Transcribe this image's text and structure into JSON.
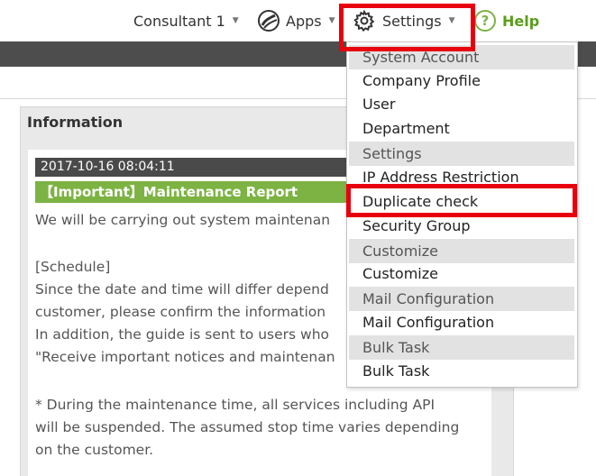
{
  "topbar": {
    "consultant_label": "Consultant 1",
    "apps_label": "Apps",
    "settings_label": "Settings",
    "help_label": "Help",
    "help_icon_glyph": "?",
    "caret": "▼"
  },
  "information": {
    "title": "Information",
    "notice": {
      "date": "2017-10-16 08:04:11",
      "heading": "【Important】Maintenance Report",
      "lines": [
        "We will be carrying out system maintenan",
        "[Schedule]",
        "Since the date and time will differ depend",
        "customer, please confirm the information",
        "In addition, the guide is sent to users who",
        "\"Receive important notices and maintenan",
        "* During the maintenance time, all services including API",
        "will be suspended. The assumed stop time varies depending",
        "on the customer."
      ]
    }
  },
  "settings_menu": {
    "items": [
      {
        "label": "System Account",
        "type": "header"
      },
      {
        "label": "Company Profile",
        "type": "item"
      },
      {
        "label": "User",
        "type": "item"
      },
      {
        "label": "Department",
        "type": "item"
      },
      {
        "label": "Settings",
        "type": "header"
      },
      {
        "label": "IP Address Restriction",
        "type": "item"
      },
      {
        "label": "Duplicate check",
        "type": "item"
      },
      {
        "label": "Security Group",
        "type": "item"
      },
      {
        "label": "Customize",
        "type": "header"
      },
      {
        "label": "Customize",
        "type": "item"
      },
      {
        "label": "Mail Configuration",
        "type": "header"
      },
      {
        "label": "Mail Configuration",
        "type": "item"
      },
      {
        "label": "Bulk Task",
        "type": "header"
      },
      {
        "label": "Bulk Task",
        "type": "item"
      }
    ]
  },
  "colors": {
    "highlight": "#e8000f",
    "accent_green": "#7cb342",
    "dark_bar": "#4d4d4d"
  },
  "icons": {
    "apps": "globe-icon",
    "settings": "gear-icon",
    "help": "help-icon"
  }
}
